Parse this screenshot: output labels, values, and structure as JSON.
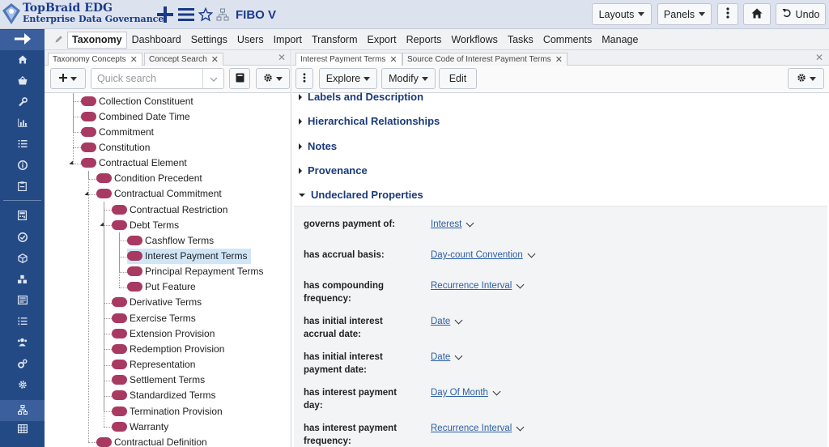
{
  "app": {
    "brand_line1": "TopBraid EDG",
    "brand_line2": "Enterprise Data Governance",
    "project": "FIBO V",
    "top_buttons": {
      "layouts": "Layouts",
      "panels": "Panels",
      "undo": "Undo"
    }
  },
  "nav": {
    "tabs": [
      "Taxonomy",
      "Dashboard",
      "Settings",
      "Users",
      "Import",
      "Transform",
      "Export",
      "Reports",
      "Workflows",
      "Tasks",
      "Comments",
      "Manage"
    ],
    "selected": "Taxonomy"
  },
  "left_panel": {
    "tabs": [
      "Taxonomy Concepts",
      "Concept Search"
    ],
    "search": {
      "placeholder": "Quick search",
      "value": ""
    },
    "tree": [
      {
        "label": "Collection Constituent",
        "level": 0
      },
      {
        "label": "Combined Date Time",
        "level": 0
      },
      {
        "label": "Commitment",
        "level": 0
      },
      {
        "label": "Constitution",
        "level": 0
      },
      {
        "label": "Contractual Element",
        "level": 0,
        "expanded": true
      },
      {
        "label": "Condition Precedent",
        "level": 1
      },
      {
        "label": "Contractual Commitment",
        "level": 1,
        "expanded": true
      },
      {
        "label": "Contractual Restriction",
        "level": 2
      },
      {
        "label": "Debt Terms",
        "level": 2,
        "expanded": true
      },
      {
        "label": "Cashflow Terms",
        "level": 3
      },
      {
        "label": "Interest Payment Terms",
        "level": 3,
        "selected": true
      },
      {
        "label": "Principal Repayment Terms",
        "level": 3
      },
      {
        "label": "Put Feature",
        "level": 3
      },
      {
        "label": "Derivative Terms",
        "level": 2
      },
      {
        "label": "Exercise Terms",
        "level": 2
      },
      {
        "label": "Extension Provision",
        "level": 2
      },
      {
        "label": "Redemption Provision",
        "level": 2
      },
      {
        "label": "Representation",
        "level": 2
      },
      {
        "label": "Settlement Terms",
        "level": 2
      },
      {
        "label": "Standardized Terms",
        "level": 2
      },
      {
        "label": "Termination Provision",
        "level": 2
      },
      {
        "label": "Warranty",
        "level": 2
      },
      {
        "label": "Contractual Definition",
        "level": 1
      }
    ]
  },
  "right_panel": {
    "tabs": [
      "Interest Payment Terms",
      "Source Code of Interest Payment Terms"
    ],
    "toolbar": {
      "explore": "Explore",
      "modify": "Modify",
      "edit": "Edit"
    },
    "sections": [
      {
        "label": "Labels and Description",
        "expanded": false
      },
      {
        "label": "Hierarchical Relationships",
        "expanded": false
      },
      {
        "label": "Notes",
        "expanded": false
      },
      {
        "label": "Provenance",
        "expanded": false
      },
      {
        "label": "Undeclared Properties",
        "expanded": true
      }
    ],
    "properties": [
      {
        "label": "governs payment of:",
        "value": "Interest"
      },
      {
        "label": "has accrual basis:",
        "value": "Day-count Convention"
      },
      {
        "label": "has compounding frequency:",
        "value": "Recurrence Interval"
      },
      {
        "label": "has initial interest accrual date:",
        "value": "Date"
      },
      {
        "label": "has initial interest payment date:",
        "value": "Date"
      },
      {
        "label": "has interest payment day:",
        "value": "Day Of Month"
      },
      {
        "label": "has interest payment frequency:",
        "value": "Recurrence Interval"
      }
    ]
  },
  "colors": {
    "sidebar": "#244a86",
    "tree_node": "#a83a62",
    "link": "#2b5fa3",
    "section_header": "#1a3a78",
    "selection": "#cfe6f7"
  },
  "icons": {
    "sidebar": [
      "arrow-right-icon",
      "home-icon",
      "basket-icon",
      "wrench-icon",
      "bar-chart-icon",
      "list-icon",
      "info-icon",
      "clipboard-icon",
      "calculator-icon",
      "check-circle-icon",
      "cube-icon",
      "cubes-icon",
      "newspaper-icon",
      "ordered-list-icon",
      "users-icon",
      "gears-icon",
      "cog-icon",
      "sitemap-icon",
      "table-icon"
    ]
  }
}
